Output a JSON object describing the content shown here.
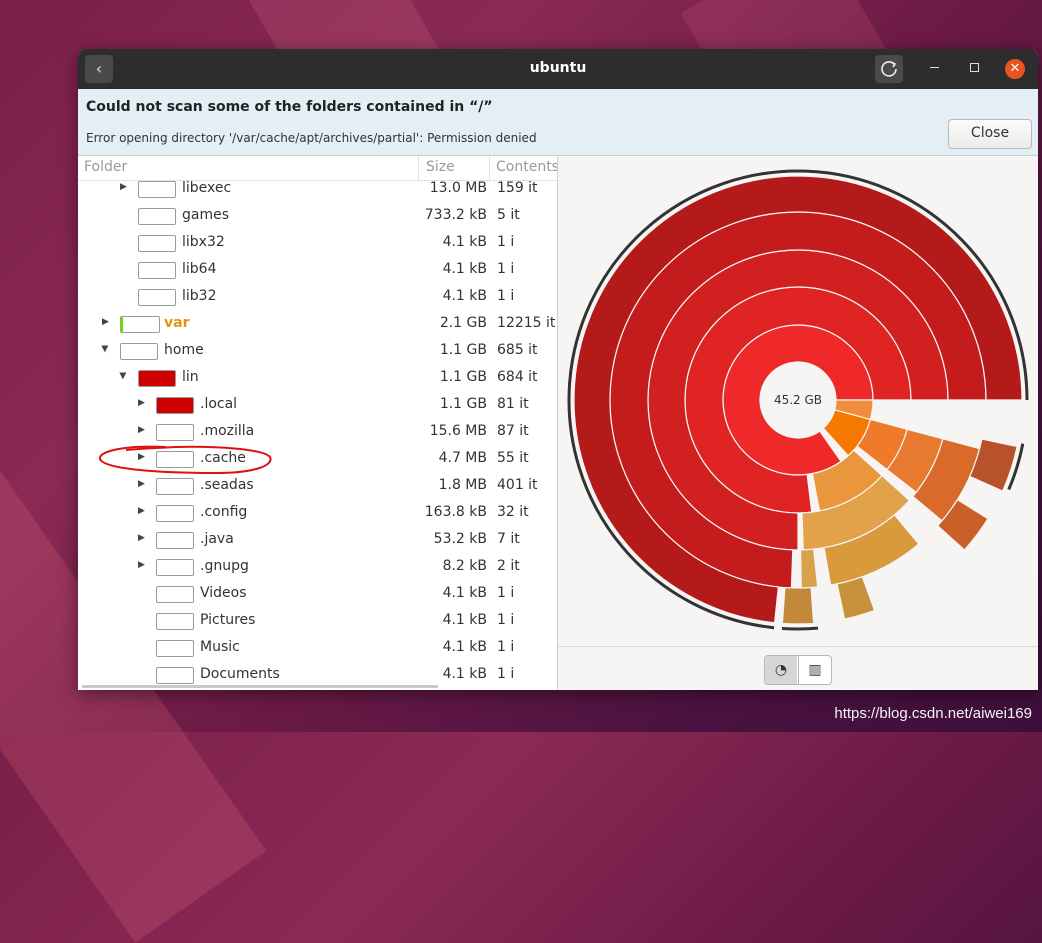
{
  "window": {
    "title": "ubuntu"
  },
  "infobar": {
    "title": "Could not scan some of the folders contained in “/”",
    "detail": "Error opening directory '/var/cache/apt/archives/partial': Permission denied",
    "close_label": "Close"
  },
  "tree": {
    "columns": {
      "folder": "Folder",
      "size": "Size",
      "contents": "Contents"
    },
    "rows": [
      {
        "name": "libexec",
        "size": "13.0 MB",
        "contents": "159 it"
      },
      {
        "name": "games",
        "size": "733.2 kB",
        "contents": "5 it"
      },
      {
        "name": "libx32",
        "size": "4.1 kB",
        "contents": "1 i"
      },
      {
        "name": "lib64",
        "size": "4.1 kB",
        "contents": "1 i"
      },
      {
        "name": "lib32",
        "size": "4.1 kB",
        "contents": "1 i"
      },
      {
        "name": "var",
        "size": "2.1 GB",
        "contents": "12215 it"
      },
      {
        "name": "home",
        "size": "1.1 GB",
        "contents": "685 it"
      },
      {
        "name": "lin",
        "size": "1.1 GB",
        "contents": "684 it"
      },
      {
        "name": ".local",
        "size": "1.1 GB",
        "contents": "81 it"
      },
      {
        "name": ".mozilla",
        "size": "15.6 MB",
        "contents": "87 it"
      },
      {
        "name": ".cache",
        "size": "4.7 MB",
        "contents": "55 it"
      },
      {
        "name": ".seadas",
        "size": "1.8 MB",
        "contents": "401 it"
      },
      {
        "name": ".config",
        "size": "163.8 kB",
        "contents": "32 it"
      },
      {
        "name": ".java",
        "size": "53.2 kB",
        "contents": "7 it"
      },
      {
        "name": ".gnupg",
        "size": "8.2 kB",
        "contents": "2 it"
      },
      {
        "name": "Videos",
        "size": "4.1 kB",
        "contents": "1 i"
      },
      {
        "name": "Pictures",
        "size": "4.1 kB",
        "contents": "1 i"
      },
      {
        "name": "Music",
        "size": "4.1 kB",
        "contents": "1 i"
      },
      {
        "name": "Documents",
        "size": "4.1 kB",
        "contents": "1 i"
      }
    ]
  },
  "chart": {
    "center_label": "45.2 GB"
  },
  "colors": {
    "accent": "#e95420",
    "usage_high": "#cc0000",
    "var_highlight": "#e5930d"
  },
  "icons": {
    "back": "chevron-left-icon",
    "refresh": "refresh-icon",
    "ring_view": "ring-chart-icon",
    "tree_view": "treemap-icon"
  },
  "watermark": "https://blog.csdn.net/aiwei169"
}
